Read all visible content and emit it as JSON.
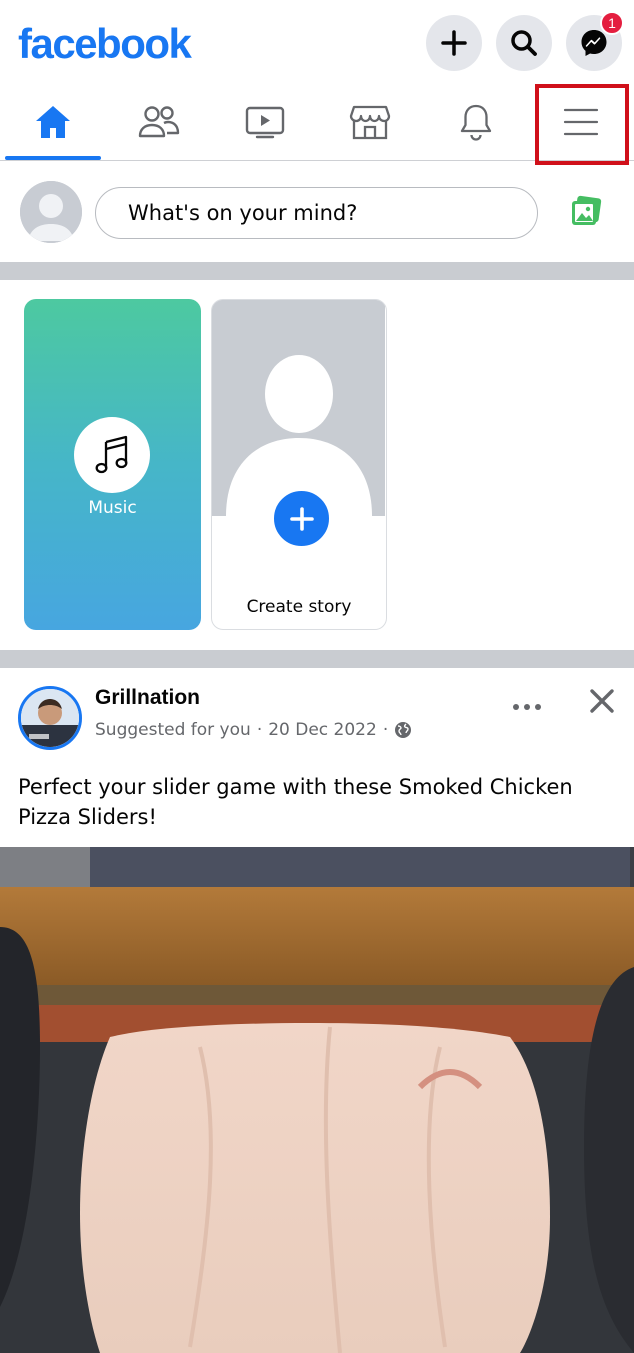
{
  "header": {
    "logo": "facebook",
    "messenger_badge": "1"
  },
  "nav": {
    "tabs": [
      {
        "name": "home",
        "active": true
      },
      {
        "name": "friends",
        "active": false
      },
      {
        "name": "watch",
        "active": false
      },
      {
        "name": "marketplace",
        "active": false
      },
      {
        "name": "notifications",
        "active": false
      },
      {
        "name": "menu",
        "active": false
      }
    ]
  },
  "composer": {
    "placeholder": "What's on your mind?"
  },
  "stories": {
    "music_label": "Music",
    "create_label": "Create story"
  },
  "post": {
    "author": "Grillnation",
    "meta_suggested": "Suggested for you",
    "meta_separator": "·",
    "meta_date": "20 Dec 2022",
    "meta_separator2": "·",
    "text": "Perfect your slider game with these Smoked Chicken Pizza Sliders!"
  },
  "colors": {
    "brand": "#1877f2",
    "highlight": "#d0101a",
    "badge": "#e41e3f"
  }
}
